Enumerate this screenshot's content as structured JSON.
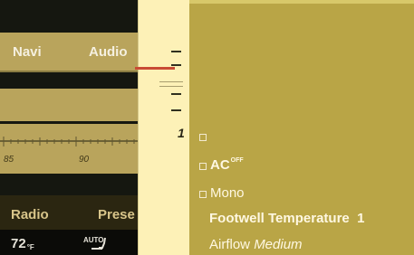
{
  "left_panel": {
    "navi_label": "Navi",
    "audio_label": "Audio",
    "scale_ticks": [
      "85",
      "90"
    ],
    "radio_label": "Radio",
    "presets_label": "Prese",
    "temperature": "72",
    "temperature_unit": "°F",
    "auto_label": "AUTO"
  },
  "strip": {
    "indicator_label": "1"
  },
  "menu": {
    "ac_label": "AC",
    "ac_state": "OFF",
    "mono_label": "Mono",
    "footwell_label": "Footwell Temperature",
    "footwell_value": "1",
    "airflow_label": "Airflow",
    "airflow_value": "Medium"
  },
  "colors": {
    "panel_gold": "#b9a546",
    "strip_yellow": "#fdf1b7",
    "dark_background": "#151710",
    "indicator_red": "#c84b34"
  }
}
